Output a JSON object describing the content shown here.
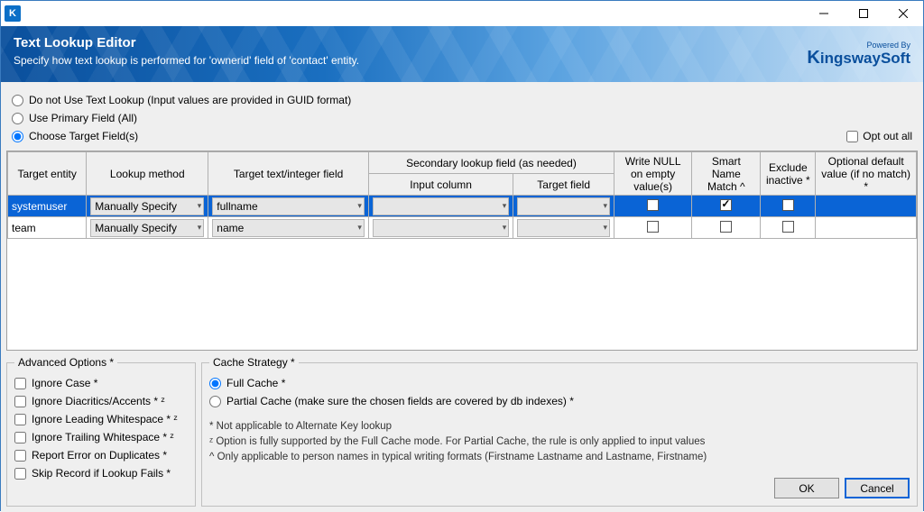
{
  "titlebar": {
    "app_letter": "K"
  },
  "banner": {
    "title": "Text Lookup Editor",
    "subtitle": "Specify how text lookup is performed for 'ownerid' field of 'contact' entity.",
    "powered_by": "Powered By",
    "brand": "KingswaySoft"
  },
  "lookup_mode": {
    "opt_no_lookup": "Do not Use Text Lookup (Input values are provided in GUID format)",
    "opt_primary": "Use Primary Field (All)",
    "opt_choose": "Choose Target Field(s)",
    "selected": "choose"
  },
  "opt_out_all": {
    "label": "Opt out all",
    "checked": false
  },
  "table": {
    "headers": {
      "target_entity": "Target entity",
      "lookup_method": "Lookup method",
      "target_field": "Target text/integer field",
      "secondary_group": "Secondary lookup field (as needed)",
      "input_column": "Input column",
      "secondary_target": "Target field",
      "write_null": "Write NULL on empty value(s)",
      "smart_name": "Smart Name Match ^",
      "exclude_inactive": "Exclude inactive *",
      "optional_default": "Optional default value (if no match) *"
    },
    "rows": [
      {
        "entity": "systemuser",
        "method": "Manually Specify",
        "target": "fullname",
        "input_col": "",
        "sec_target": "",
        "write_null": false,
        "smart": true,
        "exclude": false,
        "default": "",
        "selected": true
      },
      {
        "entity": "team",
        "method": "Manually Specify",
        "target": "name",
        "input_col": "",
        "sec_target": "",
        "write_null": false,
        "smart": false,
        "exclude": false,
        "default": "",
        "selected": false
      }
    ]
  },
  "advanced": {
    "legend": "Advanced Options *",
    "items": [
      {
        "label": "Ignore Case *",
        "checked": false
      },
      {
        "label": "Ignore Diacritics/Accents * ᶻ",
        "checked": false
      },
      {
        "label": "Ignore Leading Whitespace * ᶻ",
        "checked": false
      },
      {
        "label": "Ignore Trailing Whitespace * ᶻ",
        "checked": false
      },
      {
        "label": "Report Error on Duplicates *",
        "checked": false
      },
      {
        "label": "Skip Record if Lookup Fails *",
        "checked": false
      }
    ]
  },
  "cache": {
    "legend": "Cache Strategy *",
    "opt_full": "Full Cache *",
    "opt_partial": "Partial Cache (make sure the chosen fields are covered by db indexes) *",
    "selected": "full",
    "note1": "* Not applicable to Alternate Key lookup",
    "note2": "ᶻ Option is fully supported by the Full Cache mode. For Partial Cache, the rule is only applied to input values",
    "note3": "^ Only applicable to person names in typical writing formats (Firstname Lastname and Lastname, Firstname)"
  },
  "buttons": {
    "ok": "OK",
    "cancel": "Cancel"
  }
}
